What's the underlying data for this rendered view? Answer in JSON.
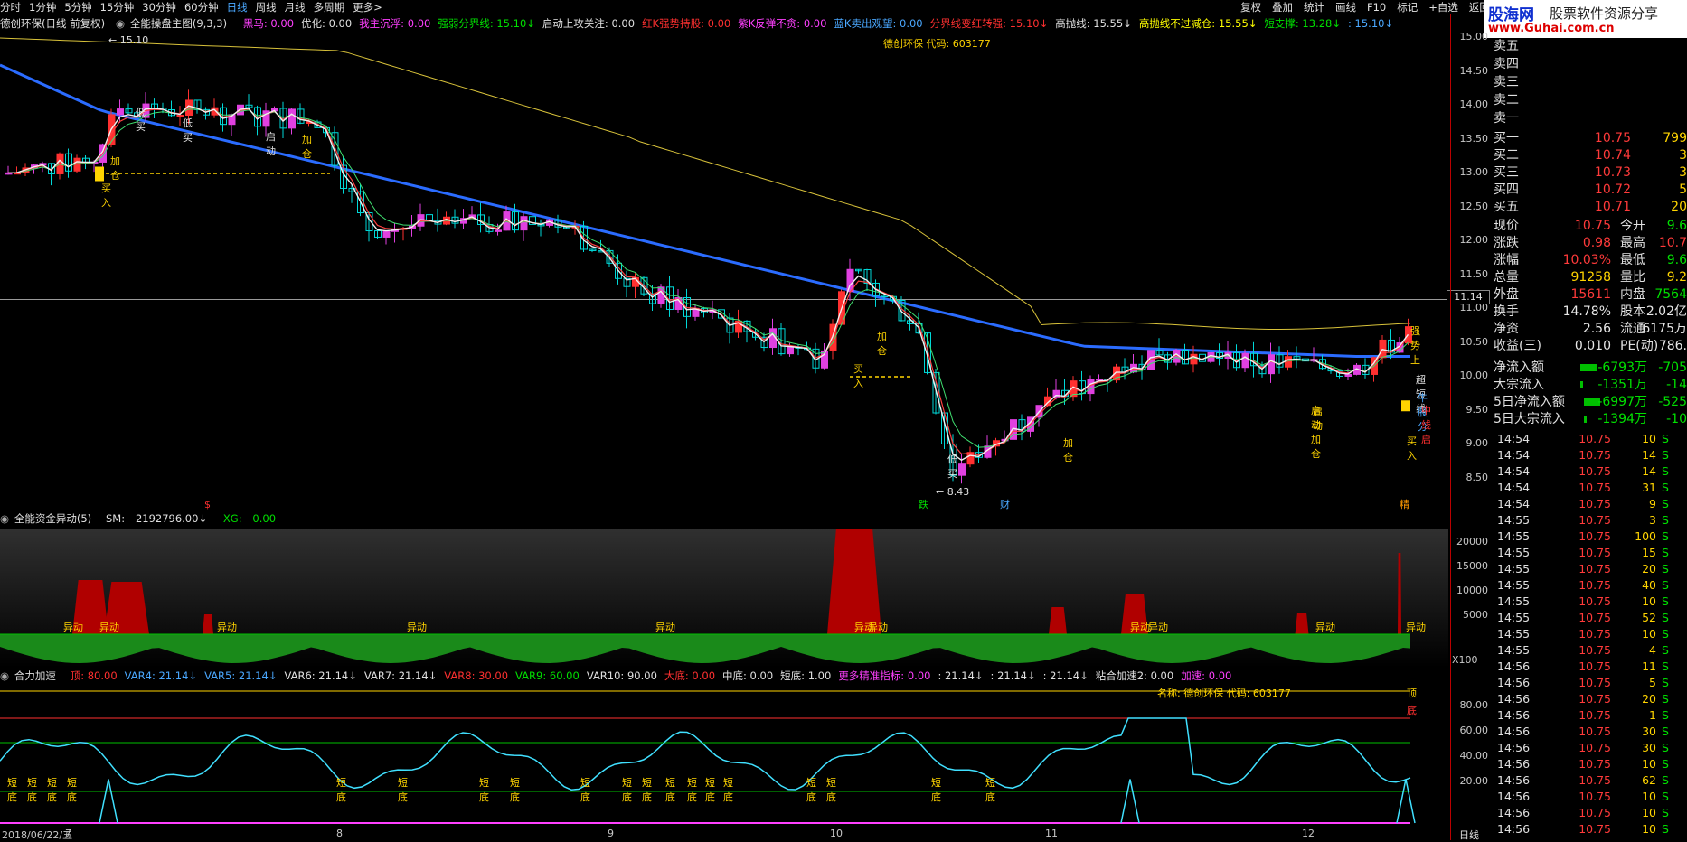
{
  "top_menu": {
    "items": [
      "分时",
      "1分钟",
      "5分钟",
      "15分钟",
      "30分钟",
      "60分钟",
      "日线",
      "周线",
      "月线",
      "多周期",
      "更多>"
    ],
    "active": "日线",
    "right_items": [
      "复权",
      "叠加",
      "统计",
      "画线",
      "F10",
      "标记",
      "+自选",
      "返回"
    ]
  },
  "logo": {
    "name": "股海网",
    "tagline": "股票软件资源分享",
    "url": "www.Guhai.com.cn"
  },
  "main_panel": {
    "title": "德创环保(日线 前复权)",
    "indicator": "全能操盘主图(9,3,3)",
    "params": [
      {
        "label": "黑马:",
        "value": "0.00",
        "color": "#ff40ff"
      },
      {
        "label": "优化:",
        "value": "0.00",
        "color": "#e0e0e0"
      },
      {
        "label": "我主沉浮:",
        "value": "0.00",
        "color": "#ff40ff"
      },
      {
        "label": "强弱分界线:",
        "value": "15.10↓",
        "color": "#00e000"
      },
      {
        "label": "启动上攻关注:",
        "value": "0.00",
        "color": "#e0e0e0"
      },
      {
        "label": "红K强势持股:",
        "value": "0.00",
        "color": "#ff3030"
      },
      {
        "label": "紫K反弹不贪:",
        "value": "0.00",
        "color": "#ff40ff"
      },
      {
        "label": "蓝K卖出观望:",
        "value": "0.00",
        "color": "#4aa8ff"
      },
      {
        "label": "分界线变红转强:",
        "value": "15.10↓",
        "color": "#ff3030"
      },
      {
        "label": "高抛线:",
        "value": "15.55↓",
        "color": "#e0e0e0"
      },
      {
        "label": "高抛线不过减仓:",
        "value": "15.55↓",
        "color": "#ffff00"
      },
      {
        "label": "短支撑:",
        "value": "13.28↓",
        "color": "#00e000"
      },
      {
        "label": ":",
        "value": "15.10↓",
        "color": "#4aa8ff"
      }
    ],
    "name_code": "德创环保 代码: 603177",
    "y_ticks": [
      "15.00",
      "14.50",
      "14.00",
      "13.50",
      "13.00",
      "12.50",
      "12.00",
      "11.50",
      "11.00",
      "10.50",
      "10.00",
      "9.50",
      "9.00",
      "8.50"
    ],
    "crosshair_price": "11.14",
    "high_label": "15.10",
    "low_label": "8.43",
    "annotations": [
      "加仓",
      "买入",
      "低买",
      "启动",
      "加仓",
      "低买",
      "加仓",
      "买入",
      "低买",
      "加仓",
      "启动",
      "买入",
      "启动加仓",
      "强势上",
      "超短线",
      "牛股分",
      "中线启",
      "跌",
      "财",
      "精",
      "$"
    ]
  },
  "fund_panel": {
    "title": "全能资金异动(5)",
    "sm_label": "SM:",
    "sm_value": "2192796.00↓",
    "xg_label": "XG:",
    "xg_value": "0.00",
    "y_ticks": [
      "20000",
      "15000",
      "10000",
      "5000"
    ],
    "unit": "X100",
    "label": "异动"
  },
  "accel_panel": {
    "title": "合力加速",
    "params": [
      {
        "label": "顶:",
        "value": "80.00",
        "color": "#ff3030"
      },
      {
        "label": "VAR4:",
        "value": "21.14↓",
        "color": "#4aa8ff"
      },
      {
        "label": "VAR5:",
        "value": "21.14↓",
        "color": "#4aa8ff"
      },
      {
        "label": "VAR6:",
        "value": "21.14↓",
        "color": "#e0e0e0"
      },
      {
        "label": "VAR7:",
        "value": "21.14↓",
        "color": "#e0e0e0"
      },
      {
        "label": "VAR8:",
        "value": "30.00",
        "color": "#ff3030"
      },
      {
        "label": "VAR9:",
        "value": "60.00",
        "color": "#00e000"
      },
      {
        "label": "VAR10:",
        "value": "90.00",
        "color": "#e0e0e0"
      },
      {
        "label": "大底:",
        "value": "0.00",
        "color": "#ff3030"
      },
      {
        "label": "中底:",
        "value": "0.00",
        "color": "#e0e0e0"
      },
      {
        "label": "短底:",
        "value": "1.00",
        "color": "#e0e0e0"
      },
      {
        "label": "更多精准指标:",
        "value": "0.00",
        "color": "#ff40ff"
      },
      {
        "label": ":",
        "value": "21.14↓",
        "color": "#e0e0e0"
      },
      {
        "label": ":",
        "value": "21.14↓",
        "color": "#e0e0e0"
      },
      {
        "label": ":",
        "value": "21.14↓",
        "color": "#e0e0e0"
      },
      {
        "label": "粘合加速2:",
        "value": "0.00",
        "color": "#e0e0e0"
      },
      {
        "label": "加速:",
        "value": "0.00",
        "color": "#ff40ff"
      }
    ],
    "name_code": "名称: 德创环保 代码: 603177",
    "y_ticks": [
      "80.00",
      "60.00",
      "40.00",
      "20.00"
    ],
    "top_label": "顶",
    "bottom_label": "底",
    "labels": [
      "短",
      "底",
      "中",
      "底"
    ]
  },
  "time_axis": {
    "start": "2018/06/22/五",
    "months": [
      "7",
      "8",
      "9",
      "10",
      "11",
      "12"
    ]
  },
  "quote": {
    "sell": [
      {
        "label": "卖五"
      },
      {
        "label": "卖四"
      },
      {
        "label": "卖三"
      },
      {
        "label": "卖二"
      },
      {
        "label": "卖一"
      }
    ],
    "buy": [
      {
        "label": "买一",
        "price": "10.75",
        "vol": "799"
      },
      {
        "label": "买二",
        "price": "10.74",
        "vol": "3"
      },
      {
        "label": "买三",
        "price": "10.73",
        "vol": "3"
      },
      {
        "label": "买四",
        "price": "10.72",
        "vol": "5"
      },
      {
        "label": "买五",
        "price": "10.71",
        "vol": "20"
      }
    ],
    "stats": [
      {
        "l": "现价",
        "v": "10.75",
        "vc": "red",
        "l2": "今开",
        "v2": "9.6",
        "v2c": "grn"
      },
      {
        "l": "涨跌",
        "v": "0.98",
        "vc": "red",
        "l2": "最高",
        "v2": "10.7",
        "v2c": "red"
      },
      {
        "l": "涨幅",
        "v": "10.03%",
        "vc": "red",
        "l2": "最低",
        "v2": "9.6",
        "v2c": "grn"
      },
      {
        "l": "总量",
        "v": "91258",
        "vc": "yel",
        "l2": "量比",
        "v2": "9.2",
        "v2c": "yel"
      },
      {
        "l": "外盘",
        "v": "15611",
        "vc": "red",
        "l2": "内盘",
        "v2": "7564",
        "v2c": "grn"
      },
      {
        "l": "换手",
        "v": "14.78%",
        "vc": "wht",
        "l2": "股本",
        "v2": "2.02亿",
        "v2c": "wht"
      },
      {
        "l": "净资",
        "v": "2.56",
        "vc": "wht",
        "l2": "流通",
        "v2": "6175万",
        "v2c": "wht"
      },
      {
        "l": "收益(三)",
        "v": "0.010",
        "vc": "wht",
        "l2": "PE(动)",
        "v2": "786.",
        "v2c": "wht"
      }
    ],
    "flows": [
      {
        "l": "净流入额",
        "v": "-6793万",
        "v2": "-705"
      },
      {
        "l": "大宗流入",
        "v": "-1351万",
        "v2": "-14"
      },
      {
        "l": "5日净流入额",
        "v": "-6997万",
        "v2": "-525"
      },
      {
        "l": "5日大宗流入",
        "v": "-1394万",
        "v2": "-10"
      }
    ],
    "ticks": [
      {
        "t": "14:54",
        "p": "10.75",
        "v": "10",
        "s": "S"
      },
      {
        "t": "14:54",
        "p": "10.75",
        "v": "14",
        "s": "S"
      },
      {
        "t": "14:54",
        "p": "10.75",
        "v": "14",
        "s": "S"
      },
      {
        "t": "14:54",
        "p": "10.75",
        "v": "31",
        "s": "S"
      },
      {
        "t": "14:54",
        "p": "10.75",
        "v": "9",
        "s": "S"
      },
      {
        "t": "14:55",
        "p": "10.75",
        "v": "3",
        "s": "S"
      },
      {
        "t": "14:55",
        "p": "10.75",
        "v": "100",
        "s": "S"
      },
      {
        "t": "14:55",
        "p": "10.75",
        "v": "15",
        "s": "S"
      },
      {
        "t": "14:55",
        "p": "10.75",
        "v": "20",
        "s": "S"
      },
      {
        "t": "14:55",
        "p": "10.75",
        "v": "40",
        "s": "S"
      },
      {
        "t": "14:55",
        "p": "10.75",
        "v": "10",
        "s": "S"
      },
      {
        "t": "14:55",
        "p": "10.75",
        "v": "52",
        "s": "S"
      },
      {
        "t": "14:55",
        "p": "10.75",
        "v": "10",
        "s": "S"
      },
      {
        "t": "14:55",
        "p": "10.75",
        "v": "4",
        "s": "S"
      },
      {
        "t": "14:56",
        "p": "10.75",
        "v": "11",
        "s": "S"
      },
      {
        "t": "14:56",
        "p": "10.75",
        "v": "5",
        "s": "S"
      },
      {
        "t": "14:56",
        "p": "10.75",
        "v": "20",
        "s": "S"
      },
      {
        "t": "14:56",
        "p": "10.75",
        "v": "1",
        "s": "S"
      },
      {
        "t": "14:56",
        "p": "10.75",
        "v": "30",
        "s": "S"
      },
      {
        "t": "14:56",
        "p": "10.75",
        "v": "30",
        "s": "S"
      },
      {
        "t": "14:56",
        "p": "10.75",
        "v": "10",
        "s": "S"
      },
      {
        "t": "14:56",
        "p": "10.75",
        "v": "62",
        "s": "S"
      },
      {
        "t": "14:56",
        "p": "10.75",
        "v": "10",
        "s": "S"
      },
      {
        "t": "14:56",
        "p": "10.75",
        "v": "10",
        "s": "S"
      },
      {
        "t": "14:56",
        "p": "10.75",
        "v": "10",
        "s": "S"
      }
    ],
    "bottom_tab": "日线"
  },
  "colors": {
    "up": "#ff3030",
    "down": "#00e5e5",
    "ma_blue": "#2b6cff",
    "ma_yellow": "#d8c23a",
    "green": "#1a8a1a",
    "dark_red": "#b00000",
    "magenta": "#ff40ff"
  }
}
